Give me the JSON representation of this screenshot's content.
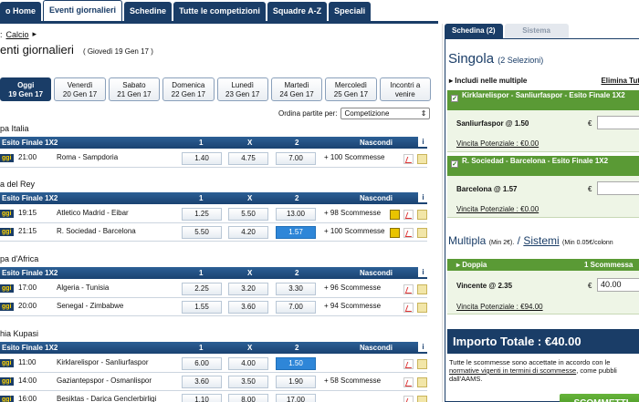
{
  "nav": {
    "tabs": [
      "o Home",
      "Eventi giornalieri",
      "Schedine",
      "Tutte le competizioni",
      "Squadre A-Z",
      "Speciali"
    ],
    "active": 1
  },
  "breadcrumb": {
    "prefix": ":",
    "link": "Calcio",
    "arrow": "▸"
  },
  "page": {
    "title": "enti giornalieri",
    "date": "( Giovedì 19 Gen 17 )"
  },
  "days": [
    {
      "name": "Oggi",
      "date": "19 Gen 17"
    },
    {
      "name": "Venerdì",
      "date": "20 Gen 17"
    },
    {
      "name": "Sabato",
      "date": "21 Gen 17"
    },
    {
      "name": "Domenica",
      "date": "22 Gen 17"
    },
    {
      "name": "Lunedì",
      "date": "23 Gen 17"
    },
    {
      "name": "Martedì",
      "date": "24 Gen 17"
    },
    {
      "name": "Mercoledì",
      "date": "25 Gen 17"
    },
    {
      "name": "Incontri a",
      "date": "venire"
    }
  ],
  "sort": {
    "label": "Ordina partite per:",
    "value": "Competizione"
  },
  "columns": {
    "c1": "1",
    "cx": "X",
    "c2": "2",
    "hide": "Nascondi",
    "info": "i"
  },
  "competitions": [
    {
      "title": "pa Italia",
      "market": "Esito Finale 1X2",
      "events": [
        {
          "oggi": "ggi",
          "time": "21:00",
          "match": "Roma   -   Sampdoria",
          "o1": "1.40",
          "ox": "4.75",
          "o2": "7.00",
          "more": "+ 100 Scommesse"
        }
      ]
    },
    {
      "title": "a del Rey",
      "market": "Esito Finale 1X2",
      "events": [
        {
          "oggi": "ggi",
          "time": "19:15",
          "match": "Atletico Madrid  -  Eibar",
          "o1": "1.25",
          "ox": "5.50",
          "o2": "13.00",
          "more": "+ 98 Scommesse"
        },
        {
          "oggi": "ggi",
          "time": "21:15",
          "match": "R. Sociedad  -  Barcelona",
          "o1": "5.50",
          "ox": "4.20",
          "o2": "1.57",
          "more": "+ 100 Scommesse"
        }
      ]
    },
    {
      "title": "pa d'Africa",
      "market": "Esito Finale 1X2",
      "events": [
        {
          "oggi": "ggi",
          "time": "17:00",
          "match": "Algeria   -   Tunisia",
          "o1": "2.25",
          "ox": "3.20",
          "o2": "3.30",
          "more": "+ 96 Scommesse"
        },
        {
          "oggi": "ggi",
          "time": "20:00",
          "match": "Senegal  -  Zimbabwe",
          "o1": "1.55",
          "ox": "3.60",
          "o2": "7.00",
          "more": "+ 94 Scommesse"
        }
      ]
    },
    {
      "title": "hia Kupasi",
      "market": "Esito Finale 1X2",
      "events": [
        {
          "oggi": "ggi",
          "time": "11:00",
          "match": "Kirklarelispor  -  Sanliurfaspor",
          "o1": "6.00",
          "ox": "4.00",
          "o2": "1.50",
          "more": ""
        },
        {
          "oggi": "ggi",
          "time": "14:00",
          "match": "Gaziantepspor  -  Osmanlispor",
          "o1": "3.60",
          "ox": "3.50",
          "o2": "1.90",
          "more": "+ 58 Scommesse"
        },
        {
          "oggi": "ggi",
          "time": "16:00",
          "match": "Besiktas  -  Darica Genclerbirligi",
          "o1": "1.10",
          "ox": "8.00",
          "o2": "17.00",
          "more": ""
        }
      ]
    }
  ],
  "slip": {
    "tab_active": "Schedina (2)",
    "tab_other": "Sistema",
    "singola": "Singola",
    "selections": "(2 Selezioni)",
    "include": "Includi nelle multiple",
    "remove_all": "Elimina Tut",
    "items": [
      {
        "title": "Kirklarelispor - Sanliurfaspor - Esito Finale 1X2",
        "pick": "Sanliurfaspor @ 1.50",
        "currency": "€",
        "stake": "",
        "potential": "Vincita Potenziale : €0.00"
      },
      {
        "title": "R. Sociedad - Barcelona - Esito Finale 1X2",
        "pick": "Barcelona @ 1.57",
        "currency": "€",
        "stake": "",
        "potential": "Vincita Potenziale : €0.00"
      }
    ],
    "multipla": "Multipla",
    "multipla_min": "(Min 2€).",
    "sep": "/",
    "sistemi": "Sistemi",
    "sistemi_min": "(Min 0.05€/colonn",
    "doppia": "Doppia",
    "doppia_count": "1 Scommessa",
    "vincente": "Vincente @ 2.35",
    "vincente_currency": "€",
    "vincente_stake": "40.00",
    "multi_potential": "Vincita Potenziale : €94.00",
    "total": "Importo Totale : €40.00",
    "note_a": "Tutte le scommesse sono accettate in accordo con le",
    "note_link": "normative vigenti in termini di scommesse",
    "note_b": ", come pubbli",
    "note_c": "dall'AAMS.",
    "button": "SCOMMETTI"
  },
  "colors": {
    "navy": "#1a3d67",
    "green": "#5a9a35",
    "selected_odd": "#2e86d8"
  }
}
